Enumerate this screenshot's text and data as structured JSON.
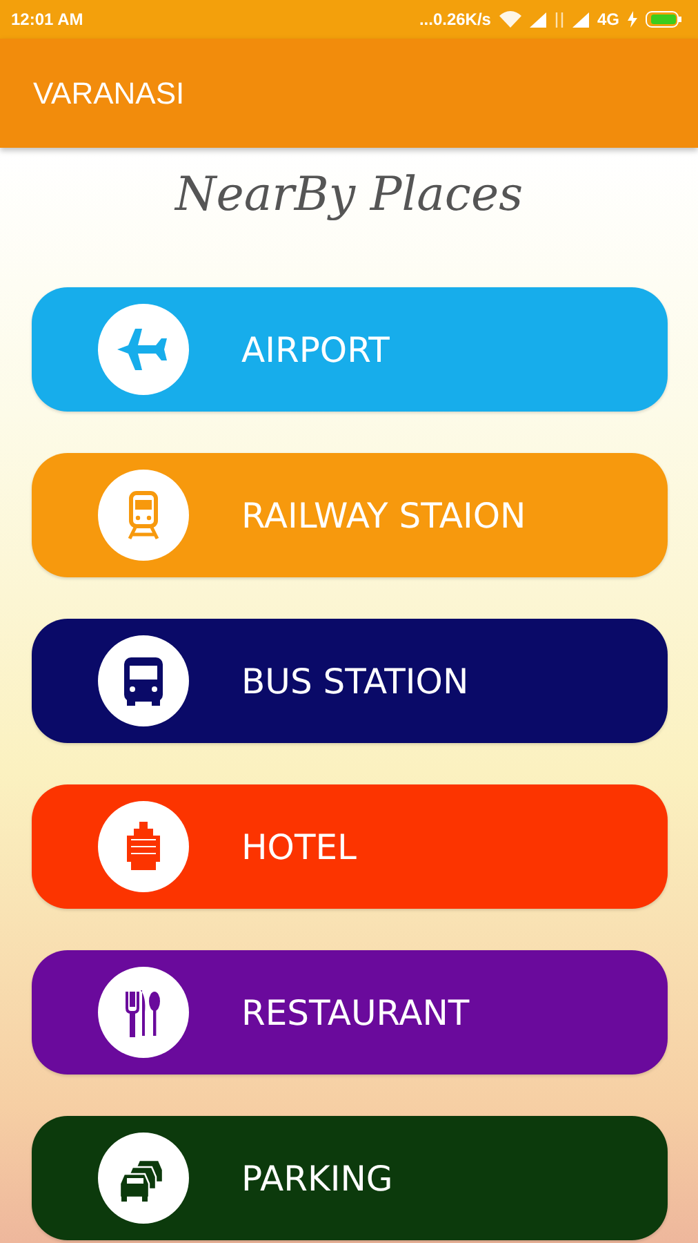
{
  "status_bar": {
    "time": "12:01 AM",
    "network_speed": "...0.26K/s",
    "network_type": "4G"
  },
  "app_bar": {
    "title": "VARANASI"
  },
  "heading": "NearBy Places",
  "places": [
    {
      "label": "AIRPORT",
      "kind": "airport",
      "color": "#17adeb"
    },
    {
      "label": "RAILWAY STAION",
      "kind": "train",
      "color": "#f7990d"
    },
    {
      "label": "BUS STATION",
      "kind": "bus",
      "color": "#0a0a68"
    },
    {
      "label": "HOTEL",
      "kind": "hotel",
      "color": "#fc3400"
    },
    {
      "label": "RESTAURANT",
      "kind": "restaurant",
      "color": "#6a0a9c"
    },
    {
      "label": "PARKING",
      "kind": "parking",
      "color": "#0c3a0c"
    }
  ]
}
